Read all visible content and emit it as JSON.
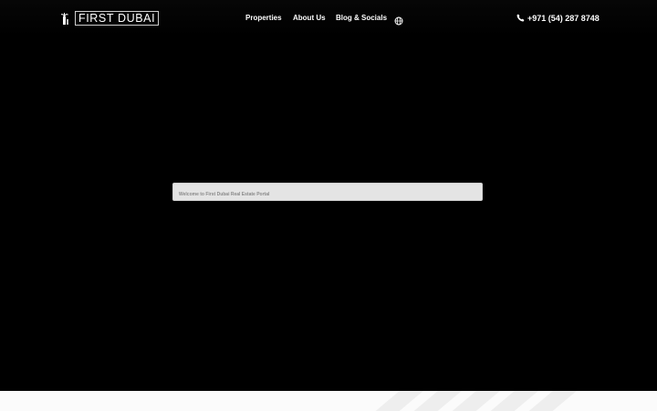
{
  "header": {
    "logo_text": "FIRST DUBAI",
    "nav": [
      {
        "label": "Properties"
      },
      {
        "label": "About Us"
      },
      {
        "label": "Blog & Socials"
      }
    ],
    "language_icon": "globe-icon",
    "phone_icon": "phone-icon",
    "phone": "+971 (54) 287 8748"
  },
  "hero": {
    "search_placeholder": "Welcome to First Dubai Real Estate Portal"
  },
  "colors": {
    "background": "#000000",
    "text": "#ffffff",
    "search_bg": "#e4e4e4",
    "footer_strip": "#fbfbfb"
  }
}
